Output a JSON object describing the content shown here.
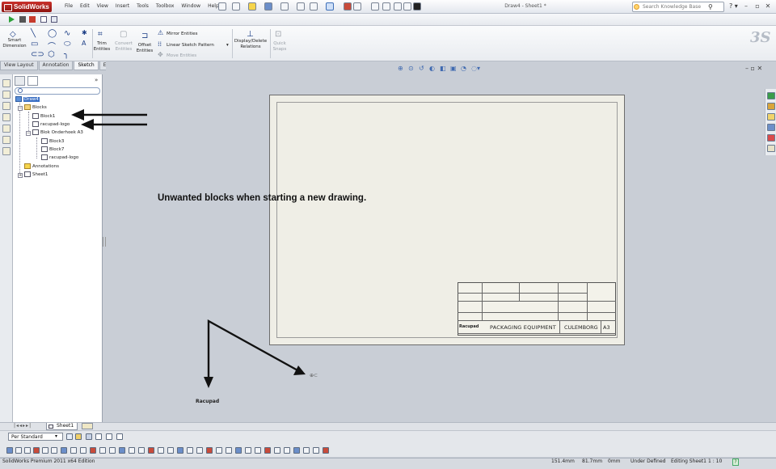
{
  "app": {
    "name": "SolidWorks",
    "document_title": "Draw4 - Sheet1 *"
  },
  "menu": [
    "File",
    "Edit",
    "View",
    "Insert",
    "Tools",
    "Toolbox",
    "Window",
    "Help"
  ],
  "search": {
    "placeholder": "Search Knowledge Base"
  },
  "command_manager": {
    "smart_dimension": "Smart Dimension",
    "trim_entities": "Trim Entities",
    "convert_entities": "Convert Entities",
    "offset_entities": "Offset Entities",
    "mirror_entities": "Mirror Entities",
    "linear_sketch_pattern": "Linear Sketch Pattern",
    "move_entities": "Move Entities",
    "display_delete_relations": "Display/Delete Relations",
    "quick_snaps": "Quick Snaps"
  },
  "tabs": [
    "View Layout",
    "Annotation",
    "Sketch",
    "Evaluate"
  ],
  "active_tab": "Sketch",
  "tree": {
    "root": "Draw4",
    "blocks_folder": "Blocks",
    "items": [
      {
        "label": "Block1"
      },
      {
        "label": "racupad-logo"
      },
      {
        "label": "Blok Onderhoek A3"
      },
      {
        "label": "Block3"
      },
      {
        "label": "Block7"
      },
      {
        "label": "racupad-logo"
      },
      {
        "label": "Annotations"
      },
      {
        "label": "Sheet1"
      }
    ]
  },
  "annotation": "Unwanted blocks when starting a new drawing.",
  "title_block": {
    "logo": "Racupad",
    "product": "PACKAGING EQUIPMENT",
    "city": "CULEMBORG",
    "size": "A3"
  },
  "stray_logo": "Racupad",
  "sheet_tab": "Sheet1",
  "layer": "Per Standard",
  "status": {
    "edition": "SolidWorks Premium 2011 x64 Edition",
    "x": "151.4mm",
    "y": "81.7mm",
    "z": "0mm",
    "state": "Under Defined",
    "editing": "Editing Sheet1",
    "scale": "1 : 10"
  }
}
